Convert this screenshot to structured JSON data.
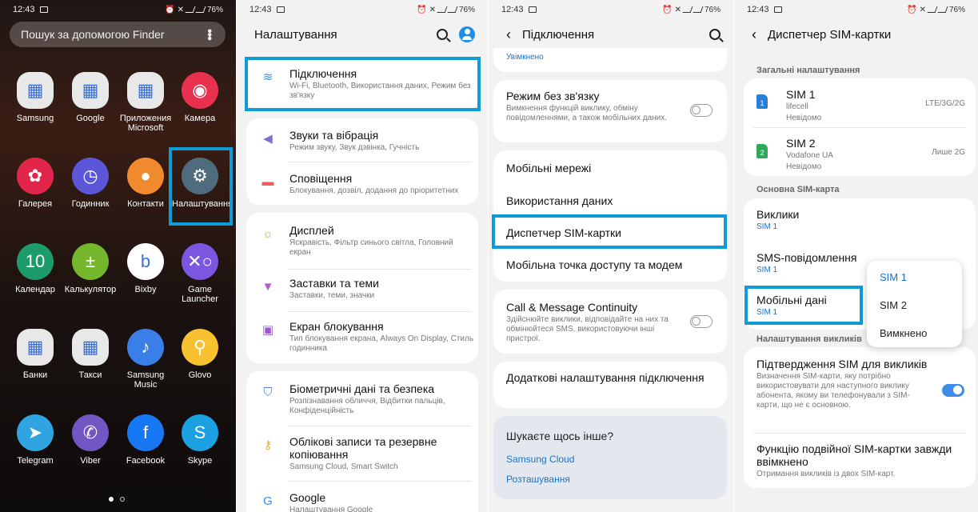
{
  "status": {
    "time": "12:43",
    "battery": "76%"
  },
  "home": {
    "search_placeholder": "Пошук за допомогою Finder",
    "apps": [
      {
        "label": "Samsung",
        "color": "#e8e8e8",
        "glyph": "▦"
      },
      {
        "label": "Google",
        "color": "#e8e8e8",
        "glyph": "▦"
      },
      {
        "label": "Приложения Microsoft",
        "color": "#e8e8e8",
        "glyph": "▦"
      },
      {
        "label": "Камера",
        "color": "#e9314f",
        "glyph": "◉"
      },
      {
        "label": "Галерея",
        "color": "#e1264a",
        "glyph": "✿"
      },
      {
        "label": "Годинник",
        "color": "#5b57d8",
        "glyph": "◷"
      },
      {
        "label": "Контакти",
        "color": "#f08a2c",
        "glyph": "●"
      },
      {
        "label": "Налаштування",
        "color": "#4f6b7e",
        "glyph": "⚙"
      },
      {
        "label": "Календар",
        "color": "#1e9b6a",
        "glyph": "10"
      },
      {
        "label": "Калькулятор",
        "color": "#74b62c",
        "glyph": "±"
      },
      {
        "label": "Bixby",
        "color": "#ffffff",
        "glyph": "b"
      },
      {
        "label": "Game Launcher",
        "color": "#7b57e0",
        "glyph": "✕○"
      },
      {
        "label": "Банки",
        "color": "#e8e8e8",
        "glyph": "▦"
      },
      {
        "label": "Такси",
        "color": "#e8e8e8",
        "glyph": "▦"
      },
      {
        "label": "Samsung Music",
        "color": "#3a7fe8",
        "glyph": "♪"
      },
      {
        "label": "Glovo",
        "color": "#f7c130",
        "glyph": "⚲"
      },
      {
        "label": "Telegram",
        "color": "#2fa4e0",
        "glyph": "➤"
      },
      {
        "label": "Viber",
        "color": "#7256c4",
        "glyph": "✆"
      },
      {
        "label": "Facebook",
        "color": "#1877f2",
        "glyph": "f"
      },
      {
        "label": "Skype",
        "color": "#1ba0e2",
        "glyph": "S"
      }
    ]
  },
  "settings": {
    "title": "Налаштування",
    "items": [
      {
        "title": "Підключення",
        "sub": "Wi-Fi, Bluetooth, Використання даних, Режим без зв'язку",
        "icon_color": "#3d8ee6",
        "glyph": "≋"
      },
      {
        "title": "Звуки та вібрація",
        "sub": "Режим звуку, Звук дзвінка, Гучність",
        "icon_color": "#7b6fd6",
        "glyph": "◀"
      },
      {
        "title": "Сповіщення",
        "sub": "Блокування, дозвіл, додання до пріоритетних",
        "icon_color": "#f05c5c",
        "glyph": "▬"
      },
      {
        "title": "Дисплей",
        "sub": "Яскравість, Фільтр синього світла, Головний екран",
        "icon_color": "#8cc63f",
        "glyph": "☼"
      },
      {
        "title": "Заставки та теми",
        "sub": "Заставки, теми, значки",
        "icon_color": "#b25ad6",
        "glyph": "▼"
      },
      {
        "title": "Екран блокування",
        "sub": "Тип блокування екрана, Always On Display, Стиль годинника",
        "icon_color": "#9b59d0",
        "glyph": "▣"
      },
      {
        "title": "Біометричні дані та безпека",
        "sub": "Розпізнавання обличчя, Відбитки пальців, Конфіденційність",
        "icon_color": "#5a7fe0",
        "glyph": "⛉"
      },
      {
        "title": "Облікові записи та резервне копіювання",
        "sub": "Samsung Cloud, Smart Switch",
        "icon_color": "#e8b030",
        "glyph": "⚷"
      },
      {
        "title": "Google",
        "sub": "Налаштування Google",
        "icon_color": "#4285f4",
        "glyph": "G"
      }
    ]
  },
  "connections": {
    "title": "Підключення",
    "top_partial": "Увімкнено",
    "airplane": {
      "title": "Режим без зв'язку",
      "sub": "Вимкнення функцій виклику, обміну повідомленнями, а також мобільних даних."
    },
    "items": [
      "Мобільні мережі",
      "Використання даних",
      "Диспетчер SIM-картки",
      "Мобільна точка доступу та модем"
    ],
    "continuity": {
      "title": "Call & Message Continuity",
      "sub": "Здійснюйте виклики, відповідайте на них та обмінюйтеся SMS, використовуючи інші пристрої."
    },
    "more": "Додаткові налаштування підключення",
    "looking": {
      "title": "Шукаєте щось інше?",
      "links": [
        "Samsung Cloud",
        "Розташування"
      ]
    }
  },
  "sim_manager": {
    "title": "Диспетчер SIM-картки",
    "general": "Загальні налаштування",
    "sims": [
      {
        "name": "SIM 1",
        "carrier": "lifecell",
        "status": "Невідомо",
        "net": "LTE/3G/2G",
        "num": "1",
        "color": "#2a7fd4"
      },
      {
        "name": "SIM 2",
        "carrier": "Vodafone UA",
        "status": "Невідомо",
        "net": "Лише 2G",
        "num": "2",
        "color": "#2fa85a"
      }
    ],
    "primary": "Основна SIM-карта",
    "calls": {
      "title": "Виклики",
      "value": "SIM 1"
    },
    "sms": {
      "title": "SMS-повідомлення",
      "value": "SIM 1"
    },
    "data": {
      "title": "Мобільні дані",
      "value": "SIM 1"
    },
    "calls_settings": "Налаштування викликів",
    "confirm": {
      "title": "Підтвердження SIM для викликів",
      "sub": "Визначення SIM-карти, яку потрібно використовувати для наступного виклику абонента, якому ви телефонували з SIM-карти, що не є основною."
    },
    "dual": {
      "title": "Функцію подвійної SIM-картки завжди ввімкнено",
      "sub": "Отримання викликів із двох SIM-карт."
    },
    "popup": [
      "SIM 1",
      "SIM 2",
      "Вимкнено"
    ]
  }
}
